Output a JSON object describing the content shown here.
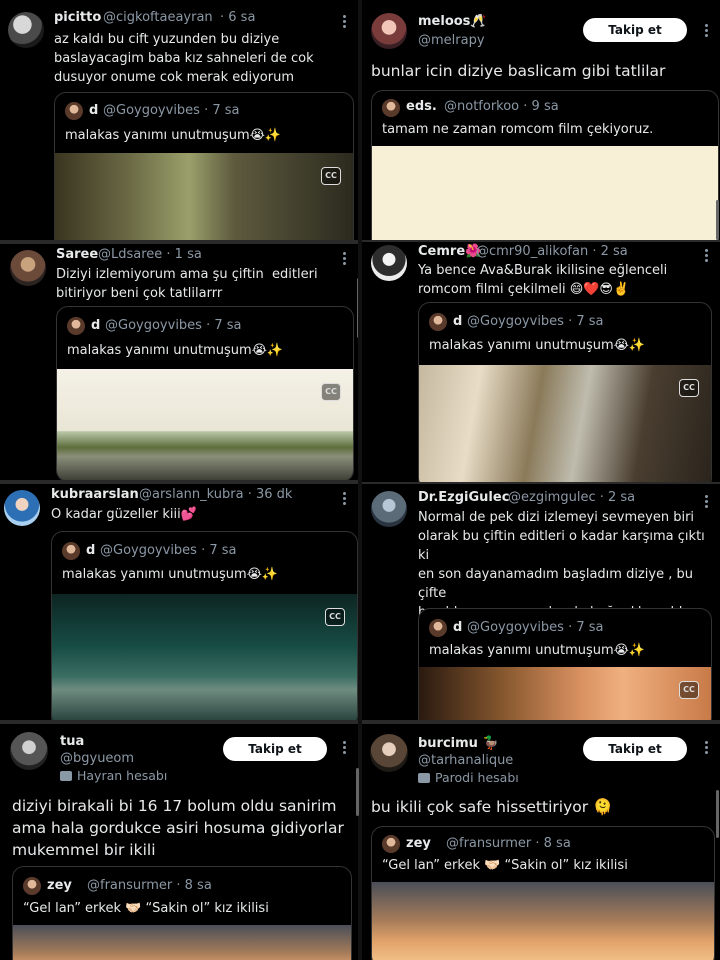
{
  "posts": [
    {
      "name": "picitto",
      "handle": "@cigkoftaeayran",
      "time": "· 6 sa",
      "text": "az kaldı bu cift yuzunden bu diziye\nbaslayacagim baba kız sahneleri de cok\ndusuyor onume cok merak ediyorum",
      "quote": {
        "name": "d",
        "handle": "@Goygoyvibes · 7 sa",
        "text": "malakas yanımı unutmuşum😭✨",
        "cc": "CC"
      }
    },
    {
      "name": "meloos🥂",
      "handle": "@melrapy",
      "follow": "Takip et",
      "text": "bunlar icin diziye baslicam gibi tatlilar",
      "quote": {
        "name": "eds.",
        "handle": "@notforkoo · 9 sa",
        "text": "tamam ne zaman romcom film çekiyoruz."
      }
    },
    {
      "name": "Saree",
      "handle": "@Ldsaree · 1 sa",
      "text": "Diziyi izlemiyorum ama şu çiftin  editleri\nbitiriyor beni çok tatlilarrr",
      "quote": {
        "name": "d",
        "handle": "@Goygoyvibes · 7 sa",
        "text": "malakas yanımı unutmuşum😭✨",
        "cc": "CC"
      }
    },
    {
      "name": "Cemre🌺",
      "handle": "@cmr90_alikofan · 2 sa",
      "text": "Ya bence Ava&Burak ikilisine eğlenceli\nromcom filmi çekilmeli 😄❤️😎✌️",
      "quote": {
        "name": "d",
        "handle": "@Goygoyvibes · 7 sa",
        "text": "malakas yanımı unutmuşum😭✨",
        "cc": "CC"
      }
    },
    {
      "name": "kubraarslan",
      "handle": "@arslann_kubra · 36 dk",
      "text": "O kadar güzeller kiii💕",
      "quote": {
        "name": "d",
        "handle": "@Goygoyvibes · 7 sa",
        "text": "malakas yanımı unutmuşum😭✨",
        "cc": "CC"
      }
    },
    {
      "name": "Dr.EzgiGulec",
      "handle": "@ezgimgulec · 2 sa",
      "text": "Normal de pek dizi izlemeyi sevmeyen biri\nolarak bu çiftin editleri o kadar karşıma çıktı ki\nen son dayanamadım başladım diziye , bu çifte\nbayıldım son zamanlar da bağımlıları oldum\nharika Bir çift 🌹",
      "quote": {
        "name": "d",
        "handle": "@Goygoyvibes · 7 sa",
        "text": "malakas yanımı unutmuşum😭✨",
        "cc": "CC"
      }
    },
    {
      "name": "tua",
      "handle": "@bgyueom",
      "badge": "Hayran hesabı",
      "follow": "Takip et",
      "text": "diziyi birakali bi 16 17 bolum oldu sanirim\nama hala gordukce asiri hosuma gidiyorlar\nmukemmel bir ikili",
      "quote": {
        "name": "zey",
        "handle": "@fransurmer · 8 sa",
        "text": "“Gel lan” erkek 🤝🏻 “Sakin ol” kız ikilisi"
      }
    },
    {
      "name": "burcimu 🦆",
      "handle": "@tarhanalique",
      "badge": "Parodi hesabı",
      "follow": "Takip et",
      "text": "bu ikili çok safe hissettiriyor 🫠",
      "quote": {
        "name": "zey",
        "handle": "@fransurmer · 8 sa",
        "text": "“Gel lan” erkek 🤝🏻 “Sakin ol” kız ikilisi"
      }
    }
  ]
}
